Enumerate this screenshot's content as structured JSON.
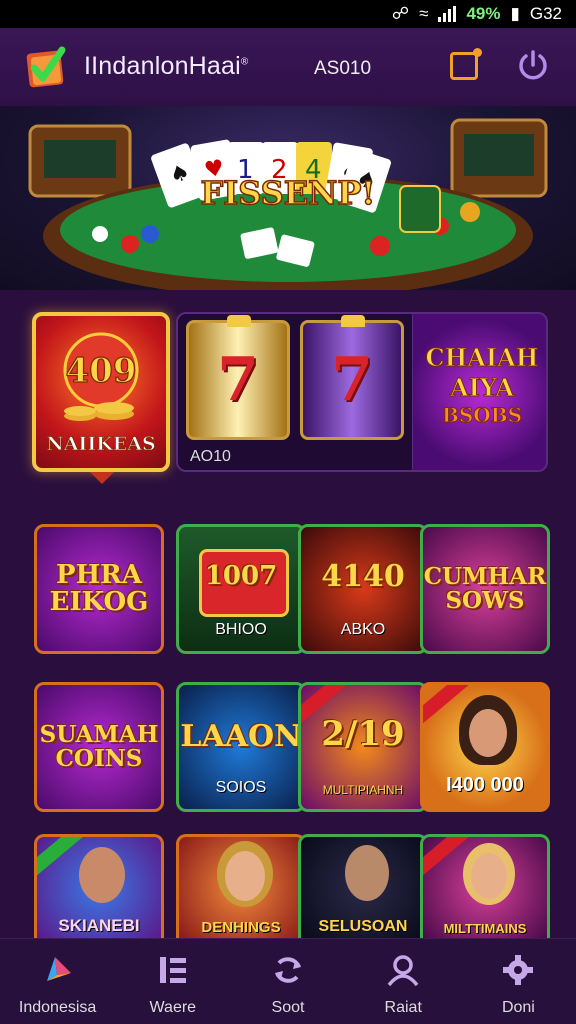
{
  "status_bar": {
    "battery": "49%",
    "time": "G32"
  },
  "header": {
    "app_title": "IIndanlonHaai",
    "trademark": "®",
    "balance": "AS010"
  },
  "banner": {
    "headline": "FISSENP!",
    "cards": [
      "1",
      "2",
      "4"
    ]
  },
  "featured_game": {
    "number": "409",
    "label": "NAIIKEAS"
  },
  "slots_panel": {
    "caption": "AO10",
    "reel_symbols": [
      "7",
      "7"
    ],
    "promo_line1": "CHAIAH",
    "promo_line2": "AIYA",
    "promo_line3": "BSOBS"
  },
  "games": [
    {
      "title_line1": "PHRA",
      "title_line2": "EIKOG",
      "sub": ""
    },
    {
      "title_line1": "1007",
      "title_line2": "",
      "sub": "BHIOO"
    },
    {
      "title_line1": "4140",
      "title_line2": "",
      "sub": "ABKO"
    },
    {
      "title_line1": "CUMHAR",
      "title_line2": "SOWS",
      "sub": ""
    },
    {
      "title_line1": "SUAMAH",
      "title_line2": "COINS",
      "sub": ""
    },
    {
      "title_line1": "LAAON",
      "title_line2": "",
      "sub": "SOIOS"
    },
    {
      "title_line1": "2/19",
      "title_line2": "",
      "sub": "MULTIPIAHNH"
    },
    {
      "title_line1": "",
      "title_line2": "",
      "sub": "I400 000"
    },
    {
      "title_line1": "",
      "title_line2": "",
      "sub": "SKIANEBI"
    },
    {
      "title_line1": "",
      "title_line2": "",
      "sub": "DENHINGS"
    },
    {
      "title_line1": "",
      "title_line2": "",
      "sub": "SELUSOAN"
    },
    {
      "title_line1": "",
      "title_line2": "",
      "sub": "MILTTIMAINS"
    }
  ],
  "bottom_nav": [
    {
      "label": "Indonesisa",
      "icon": "play-arrow-icon"
    },
    {
      "label": "Waere",
      "icon": "menu-list-icon"
    },
    {
      "label": "Soot",
      "icon": "refresh-icon"
    },
    {
      "label": "Raiat",
      "icon": "user-icon"
    },
    {
      "label": "Doni",
      "icon": "gear-icon"
    }
  ],
  "colors": {
    "background": "#2a0f3e",
    "header": "#3a1656",
    "accent_gold": "#f3c843",
    "accent_orange": "#f0a128",
    "nav": "#28103c"
  }
}
